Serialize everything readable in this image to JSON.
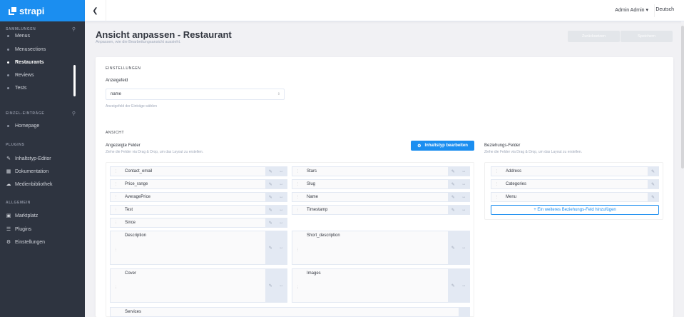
{
  "brand": {
    "name": "strapi"
  },
  "sidebar": {
    "sections": [
      {
        "title": "SAMMLUNGEN",
        "items": [
          "Menus",
          "Menusections",
          "Restaurants",
          "Reviews",
          "Tests"
        ]
      },
      {
        "title": "EINZEL-EINTRÄGE",
        "items": [
          "Homepage"
        ]
      },
      {
        "title": "PLUGINS",
        "items": [
          "Inhaltstyp-Editor",
          "Dokumentation",
          "Medienbibliothek"
        ]
      },
      {
        "title": "ALLGEMEIN",
        "items": [
          "Marktplatz",
          "Plugins",
          "Einstellungen"
        ]
      }
    ],
    "active_item": "Restaurants"
  },
  "topbar": {
    "user": "Admin Admin",
    "language": "Deutsch"
  },
  "page": {
    "title": "Ansicht anpassen - Restaurant",
    "subtitle": "Anpassen, wie die Bearbeitungsansicht aussieht.",
    "reset_label": "Zurücksetzen",
    "save_label": "Speichern"
  },
  "settings": {
    "section_label": "EINSTELLUNGEN",
    "display_field_label": "Anzeigefeld",
    "display_field_value": "name",
    "display_field_hint": "Anzeigefeld der Einträge wählen"
  },
  "view": {
    "section_label": "ANSICHT",
    "displayed_fields_label": "Angezeigte Felder",
    "displayed_fields_hint": "Ziehe die Felder via Drag & Drop, um das Layout zu erstellen.",
    "edit_type_button": "Inhaltstyp bearbeiten",
    "relation_fields_label": "Beziehungs-Felder",
    "relation_fields_hint": "Ziehe die Felder via Drag & Drop, um das Layout zu erstellen.",
    "fields_left": [
      "Contact_email",
      "Price_range",
      "AveragePrice",
      "Test",
      "Since"
    ],
    "fields_right": [
      "Stars",
      "Slug",
      "Name",
      "Timestamp"
    ],
    "tall_fields": [
      "Description",
      "Short_description",
      "Cover",
      "Images"
    ],
    "wide_fields": [
      "Services"
    ],
    "relations": [
      "Address",
      "Categories",
      "Menu"
    ],
    "add_relation_label": "+ Ein weiteres Beziehungs-Feld hinzufügen"
  },
  "colors": {
    "accent": "#1b8ef0",
    "sidebar": "#2e3440"
  }
}
